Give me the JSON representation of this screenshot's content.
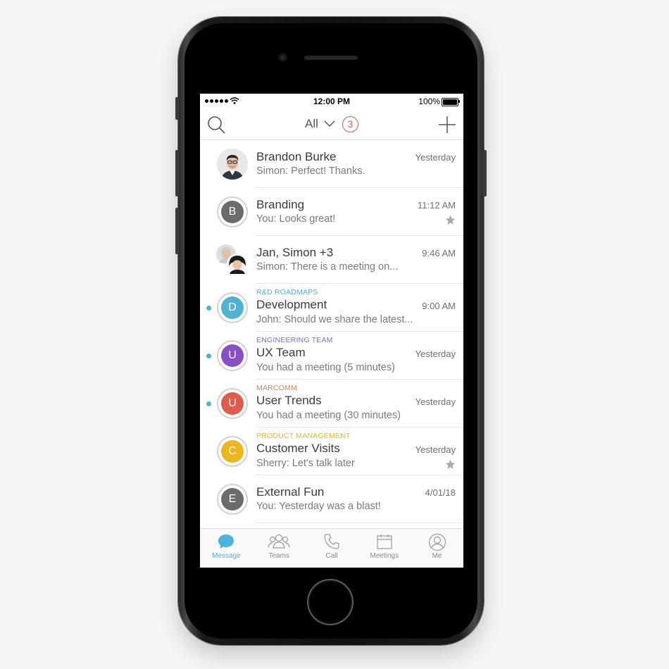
{
  "status_bar": {
    "time": "12:00 PM",
    "battery": "100%"
  },
  "header": {
    "filter_label": "All",
    "badge_count": "3",
    "search_icon": "search-icon",
    "add_icon": "plus-icon"
  },
  "conversations": [
    {
      "team": "",
      "name": "Brandon Burke",
      "preview": "Simon: Perfect! Thanks.",
      "date": "Yesterday",
      "avatar_type": "photo",
      "unread": false,
      "starred": false
    },
    {
      "team": "",
      "name": "Branding",
      "preview": "You: Looks great!",
      "date": "11:12 AM",
      "avatar_letter": "B",
      "avatar_color": "#6b6b6b",
      "unread": false,
      "starred": true
    },
    {
      "team": "",
      "name": "Jan, Simon +3",
      "preview": "Simon: There is a meeting on...",
      "date": "9:46 AM",
      "avatar_type": "group-photo",
      "unread": false,
      "starred": false
    },
    {
      "team": "R&D ROADMAPS",
      "team_color": "#49b3de",
      "name": "Development",
      "preview": "John: Should we share the latest...",
      "date": "9:00 AM",
      "avatar_letter": "D",
      "avatar_color": "#4fb3d4",
      "unread": true,
      "starred": false
    },
    {
      "team": "ENGINEERING TEAM",
      "team_color": "#8a68c9",
      "name": "UX Team",
      "preview": "You had a meeting (5 minutes)",
      "date": "Yesterday",
      "avatar_letter": "U",
      "avatar_color": "#8a4fc8",
      "unread": true,
      "starred": false
    },
    {
      "team": "MARCOMM",
      "team_color": "#e0814f",
      "name": "User Trends",
      "preview": "You had a meeting (30 minutes)",
      "date": "Yesterday",
      "avatar_letter": "U",
      "avatar_color": "#e05b4a",
      "unread": true,
      "starred": false
    },
    {
      "team": "PRODUCT MANAGEMENT",
      "team_color": "#efb51c",
      "name": "Customer Visits",
      "preview": "Sherry: Let's talk later",
      "date": "Yesterday",
      "avatar_letter": "C",
      "avatar_color": "#efb51c",
      "unread": false,
      "starred": true
    },
    {
      "team": "",
      "name": "External Fun",
      "preview": "You: Yesterday was a blast!",
      "date": "4/01/18",
      "avatar_letter": "E",
      "avatar_color": "#6b6b6b",
      "unread": false,
      "starred": false
    }
  ],
  "tabs": [
    {
      "label": "Message",
      "icon": "message-icon",
      "active": true
    },
    {
      "label": "Teams",
      "icon": "teams-icon",
      "active": false
    },
    {
      "label": "Call",
      "icon": "phone-icon",
      "active": false
    },
    {
      "label": "Meetings",
      "icon": "calendar-icon",
      "active": false
    },
    {
      "label": "Me",
      "icon": "profile-icon",
      "active": false
    }
  ],
  "colors": {
    "accent": "#49b3de",
    "badge": "#c0644a",
    "star": "#a9a9a9"
  }
}
